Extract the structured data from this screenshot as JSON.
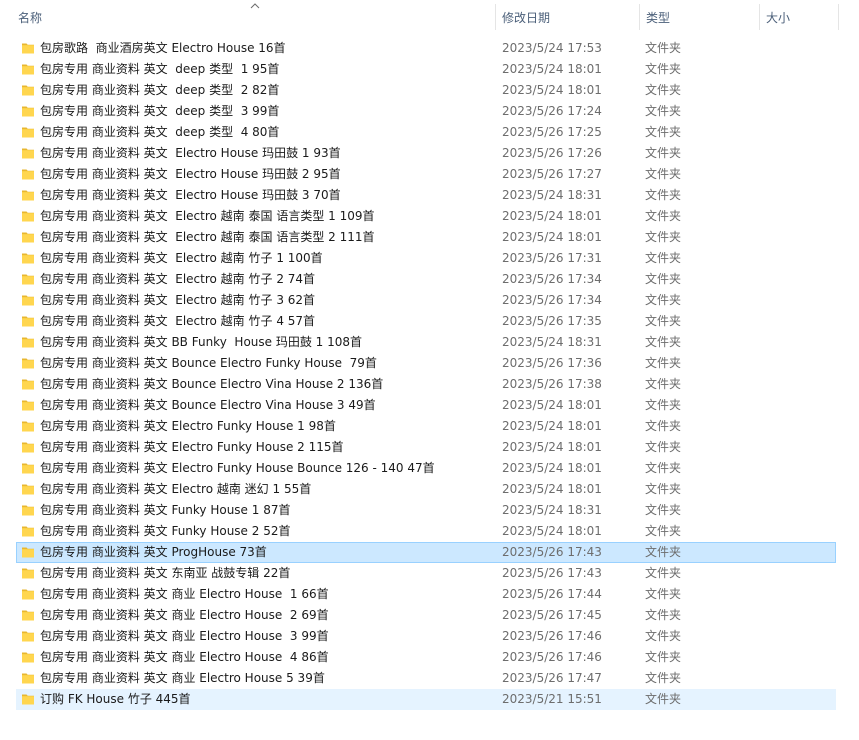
{
  "columns": {
    "name": "名称",
    "date": "修改日期",
    "type": "类型",
    "size": "大小"
  },
  "sort": {
    "column": "name",
    "direction": "ascending",
    "icon": "chevron-up-icon"
  },
  "icons": {
    "folder": "folder-icon"
  },
  "colors": {
    "selected_bg": "#cce8ff",
    "selected_border": "#99d1ff",
    "hover_bg": "#e5f3ff",
    "folder": "#ffd64f"
  },
  "files": [
    {
      "name": "包房歌路  商业酒房英文 Electro House 16首",
      "date": "2023/5/24 17:53",
      "type": "文件夹",
      "size": "",
      "state": ""
    },
    {
      "name": "包房专用 商业资料 英文  deep 类型  1 95首",
      "date": "2023/5/24 18:01",
      "type": "文件夹",
      "size": "",
      "state": ""
    },
    {
      "name": "包房专用 商业资料 英文  deep 类型  2 82首",
      "date": "2023/5/24 18:01",
      "type": "文件夹",
      "size": "",
      "state": ""
    },
    {
      "name": "包房专用 商业资料 英文  deep 类型  3 99首",
      "date": "2023/5/26 17:24",
      "type": "文件夹",
      "size": "",
      "state": ""
    },
    {
      "name": "包房专用 商业资料 英文  deep 类型  4 80首",
      "date": "2023/5/26 17:25",
      "type": "文件夹",
      "size": "",
      "state": ""
    },
    {
      "name": "包房专用 商业资料 英文  Electro House 玛田鼓 1 93首",
      "date": "2023/5/26 17:26",
      "type": "文件夹",
      "size": "",
      "state": ""
    },
    {
      "name": "包房专用 商业资料 英文  Electro House 玛田鼓 2 95首",
      "date": "2023/5/26 17:27",
      "type": "文件夹",
      "size": "",
      "state": ""
    },
    {
      "name": "包房专用 商业资料 英文  Electro House 玛田鼓 3 70首",
      "date": "2023/5/24 18:31",
      "type": "文件夹",
      "size": "",
      "state": ""
    },
    {
      "name": "包房专用 商业资料 英文  Electro 越南 泰国 语言类型 1 109首",
      "date": "2023/5/24 18:01",
      "type": "文件夹",
      "size": "",
      "state": ""
    },
    {
      "name": "包房专用 商业资料 英文  Electro 越南 泰国 语言类型 2 111首",
      "date": "2023/5/24 18:01",
      "type": "文件夹",
      "size": "",
      "state": ""
    },
    {
      "name": "包房专用 商业资料 英文  Electro 越南 竹子 1 100首",
      "date": "2023/5/26 17:31",
      "type": "文件夹",
      "size": "",
      "state": ""
    },
    {
      "name": "包房专用 商业资料 英文  Electro 越南 竹子 2 74首",
      "date": "2023/5/26 17:34",
      "type": "文件夹",
      "size": "",
      "state": ""
    },
    {
      "name": "包房专用 商业资料 英文  Electro 越南 竹子 3 62首",
      "date": "2023/5/26 17:34",
      "type": "文件夹",
      "size": "",
      "state": ""
    },
    {
      "name": "包房专用 商业资料 英文  Electro 越南 竹子 4 57首",
      "date": "2023/5/26 17:35",
      "type": "文件夹",
      "size": "",
      "state": ""
    },
    {
      "name": "包房专用 商业资料 英文 BB Funky  House 玛田鼓 1 108首",
      "date": "2023/5/24 18:31",
      "type": "文件夹",
      "size": "",
      "state": ""
    },
    {
      "name": "包房专用 商业资料 英文 Bounce Electro Funky House  79首",
      "date": "2023/5/26 17:36",
      "type": "文件夹",
      "size": "",
      "state": ""
    },
    {
      "name": "包房专用 商业资料 英文 Bounce Electro Vina House 2 136首",
      "date": "2023/5/26 17:38",
      "type": "文件夹",
      "size": "",
      "state": ""
    },
    {
      "name": "包房专用 商业资料 英文 Bounce Electro Vina House 3 49首",
      "date": "2023/5/24 18:01",
      "type": "文件夹",
      "size": "",
      "state": ""
    },
    {
      "name": "包房专用 商业资料 英文 Electro Funky House 1 98首",
      "date": "2023/5/24 18:01",
      "type": "文件夹",
      "size": "",
      "state": ""
    },
    {
      "name": "包房专用 商业资料 英文 Electro Funky House 2 115首",
      "date": "2023/5/24 18:01",
      "type": "文件夹",
      "size": "",
      "state": ""
    },
    {
      "name": "包房专用 商业资料 英文 Electro Funky House Bounce 126 - 140 47首",
      "date": "2023/5/24 18:01",
      "type": "文件夹",
      "size": "",
      "state": ""
    },
    {
      "name": "包房专用 商业资料 英文 Electro 越南 迷幻 1 55首",
      "date": "2023/5/24 18:01",
      "type": "文件夹",
      "size": "",
      "state": ""
    },
    {
      "name": "包房专用 商业资料 英文 Funky House 1 87首",
      "date": "2023/5/24 18:31",
      "type": "文件夹",
      "size": "",
      "state": ""
    },
    {
      "name": "包房专用 商业资料 英文 Funky House 2 52首",
      "date": "2023/5/24 18:01",
      "type": "文件夹",
      "size": "",
      "state": ""
    },
    {
      "name": "包房专用 商业资料 英文 ProgHouse 73首",
      "date": "2023/5/26 17:43",
      "type": "文件夹",
      "size": "",
      "state": "selected"
    },
    {
      "name": "包房专用 商业资料 英文 东南亚 战鼓专辑 22首",
      "date": "2023/5/26 17:43",
      "type": "文件夹",
      "size": "",
      "state": ""
    },
    {
      "name": "包房专用 商业资料 英文 商业 Electro House  1 66首",
      "date": "2023/5/26 17:44",
      "type": "文件夹",
      "size": "",
      "state": ""
    },
    {
      "name": "包房专用 商业资料 英文 商业 Electro House  2 69首",
      "date": "2023/5/26 17:45",
      "type": "文件夹",
      "size": "",
      "state": ""
    },
    {
      "name": "包房专用 商业资料 英文 商业 Electro House  3 99首",
      "date": "2023/5/26 17:46",
      "type": "文件夹",
      "size": "",
      "state": ""
    },
    {
      "name": "包房专用 商业资料 英文 商业 Electro House  4 86首",
      "date": "2023/5/26 17:46",
      "type": "文件夹",
      "size": "",
      "state": ""
    },
    {
      "name": "包房专用 商业资料 英文 商业 Electro House 5 39首",
      "date": "2023/5/26 17:47",
      "type": "文件夹",
      "size": "",
      "state": ""
    },
    {
      "name": "订购 FK House 竹子 445首",
      "date": "2023/5/21 15:51",
      "type": "文件夹",
      "size": "",
      "state": "hover"
    }
  ]
}
